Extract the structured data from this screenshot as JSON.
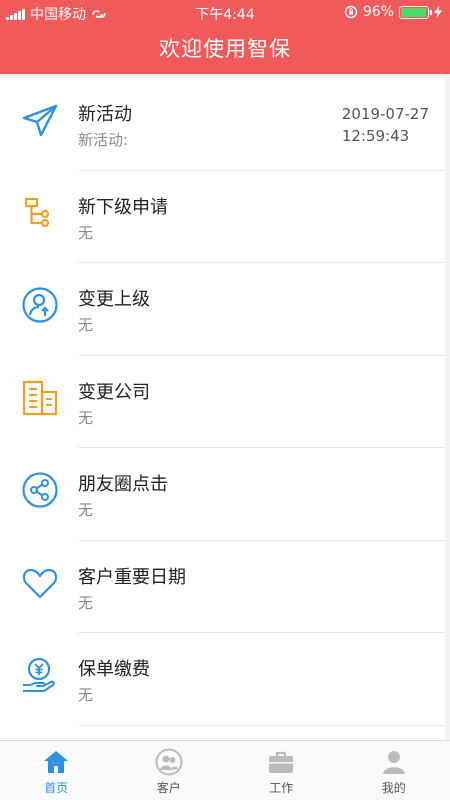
{
  "status_bar": {
    "carrier": "中国移动",
    "time": "下午4:44",
    "battery_percent": "96%",
    "battery_level": 0.96
  },
  "header": {
    "title": "欢迎使用智保"
  },
  "list": [
    {
      "icon": "paper-plane-icon",
      "title": "新活动",
      "subtitle": "新活动:",
      "date": "2019-07-27",
      "time": "12:59:43"
    },
    {
      "icon": "org-tree-icon",
      "title": "新下级申请",
      "subtitle": "无"
    },
    {
      "icon": "user-upgrade-icon",
      "title": "变更上级",
      "subtitle": "无"
    },
    {
      "icon": "building-icon",
      "title": "变更公司",
      "subtitle": "无"
    },
    {
      "icon": "share-icon",
      "title": "朋友圈点击",
      "subtitle": "无"
    },
    {
      "icon": "heart-icon",
      "title": "客户重要日期",
      "subtitle": "无"
    },
    {
      "icon": "payment-icon",
      "title": "保单缴费",
      "subtitle": "无"
    }
  ],
  "tabs": [
    {
      "icon": "home-icon",
      "label": "首页",
      "active": true
    },
    {
      "icon": "customers-icon",
      "label": "客户",
      "active": false
    },
    {
      "icon": "briefcase-icon",
      "label": "工作",
      "active": false
    },
    {
      "icon": "profile-icon",
      "label": "我的",
      "active": false
    }
  ],
  "colors": {
    "header_bg": "#f05a5a",
    "accent_blue": "#2f8fe0",
    "accent_orange": "#f0a020",
    "battery_green": "#4cd964"
  }
}
